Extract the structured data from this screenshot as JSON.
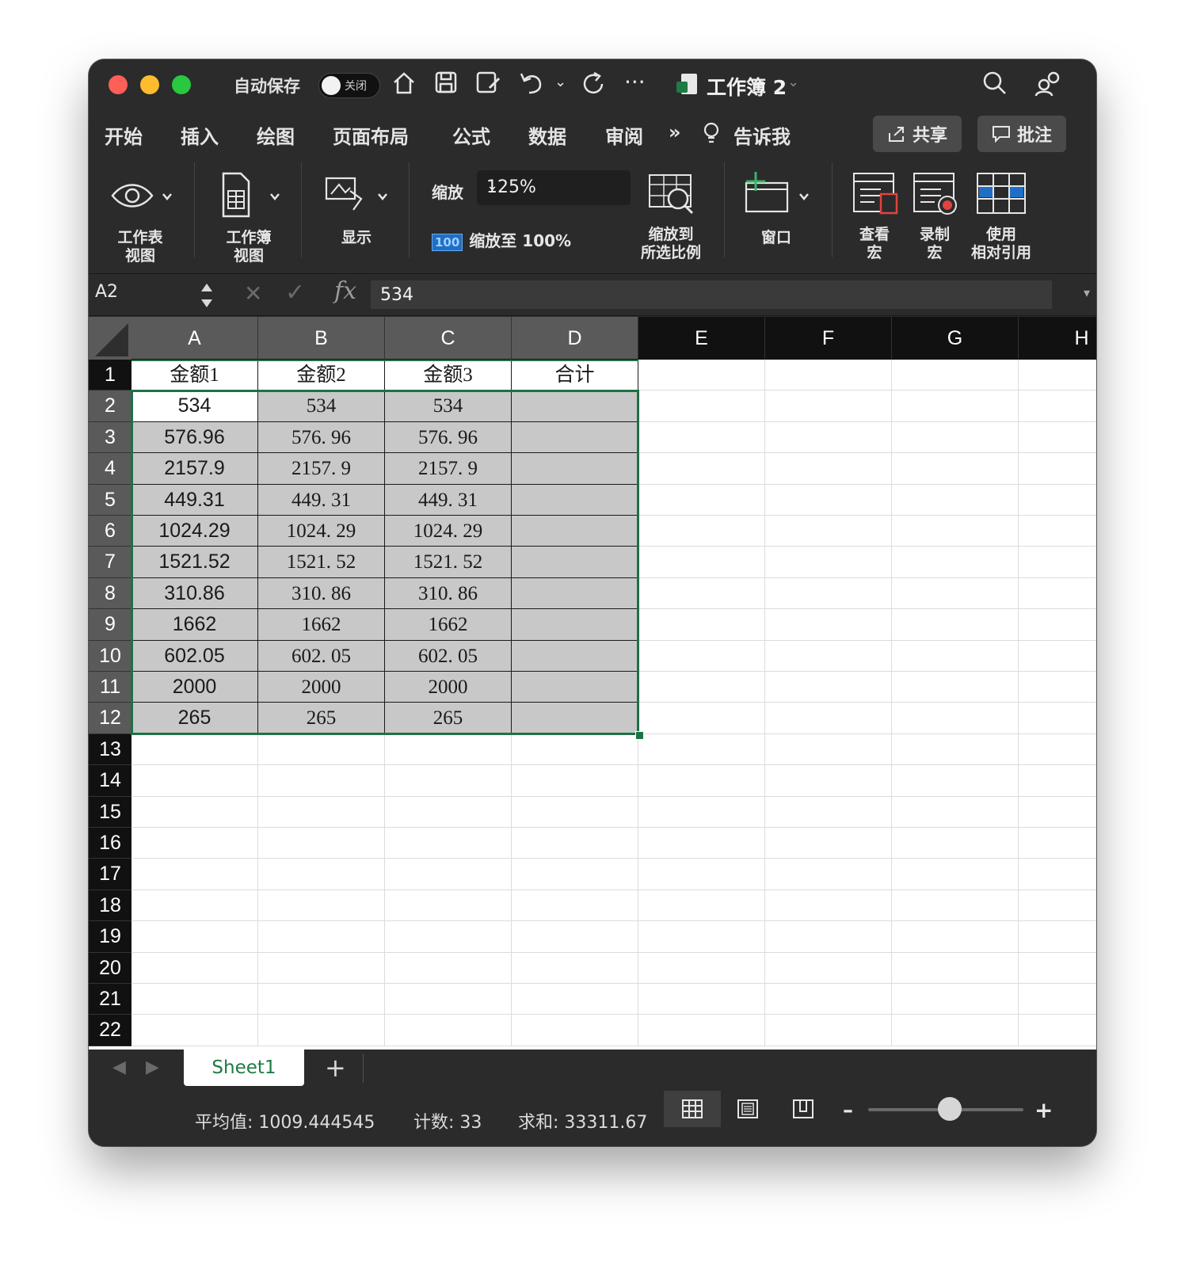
{
  "titlebar": {
    "autosave_label": "自动保存",
    "autosave_state": "关闭",
    "document_title": "工作簿 2"
  },
  "ribbon_tabs": [
    {
      "label": "开始"
    },
    {
      "label": "插入"
    },
    {
      "label": "绘图"
    },
    {
      "label": "页面布局"
    },
    {
      "label": "公式"
    },
    {
      "label": "数据"
    },
    {
      "label": "审阅"
    },
    {
      "label": "告诉我"
    }
  ],
  "actions": {
    "share_label": "共享",
    "comment_label": "批注"
  },
  "ribbon": {
    "sheet_view_1": "工作表",
    "sheet_view_2": "视图",
    "workbook_view_1": "工作簿",
    "workbook_view_2": "视图",
    "show": "显示",
    "zoom_label": "缩放",
    "zoom_value": "125%",
    "zoom100_badge": "100",
    "zoom100_label": "缩放至 100%",
    "zoom_sel_1": "缩放到",
    "zoom_sel_2": "所选比例",
    "window": "窗口",
    "view_macro_1": "查看",
    "view_macro_2": "宏",
    "record_macro_1": "录制",
    "record_macro_2": "宏",
    "relative_ref_1": "使用",
    "relative_ref_2": "相对引用"
  },
  "formula_bar": {
    "name_box": "A2",
    "fx": "fx",
    "value": "534"
  },
  "grid": {
    "columns": [
      "A",
      "B",
      "C",
      "D",
      "E",
      "F",
      "G",
      "H"
    ],
    "rows": [
      "1",
      "2",
      "3",
      "4",
      "5",
      "6",
      "7",
      "8",
      "9",
      "10",
      "11",
      "12",
      "13",
      "14",
      "15",
      "16",
      "17",
      "18",
      "19",
      "20",
      "21",
      "22"
    ],
    "header_row": [
      "金额1",
      "金额2",
      "金额3",
      "合计"
    ],
    "col_a": [
      "534",
      "576.96",
      "2157.9",
      "449.31",
      "1024.29",
      "1521.52",
      "310.86",
      "1662",
      "602.05",
      "2000",
      "265"
    ],
    "col_b": [
      "534",
      "576. 96",
      "2157. 9",
      "449. 31",
      "1024. 29",
      "1521. 52",
      "310. 86",
      "1662",
      "602. 05",
      "2000",
      "265"
    ],
    "col_c": [
      "534",
      "576. 96",
      "2157. 9",
      "449. 31",
      "1024. 29",
      "1521. 52",
      "310. 86",
      "1662",
      "602. 05",
      "2000",
      "265"
    ]
  },
  "sheets": [
    {
      "label": "Sheet1"
    }
  ],
  "statusbar": {
    "average": "平均值: 1009.444545",
    "count": "计数: 33",
    "sum": "求和: 33311.67"
  },
  "colors": {
    "selection_border": "#1e7145",
    "selected_fill": "#c8c8c8",
    "header_dark": "#111111",
    "header_selected": "#5a5a5a",
    "chrome": "#2b2b2b"
  }
}
